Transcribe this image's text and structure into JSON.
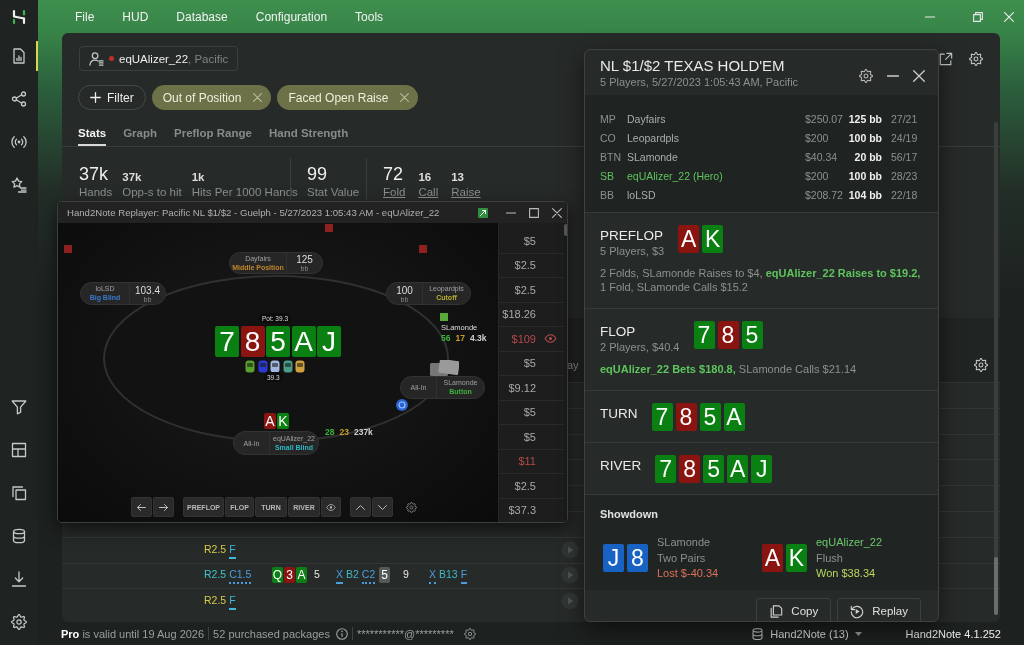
{
  "menu": [
    "File",
    "HUD",
    "Database",
    "Configuration",
    "Tools"
  ],
  "sidebar": {
    "top_items": [
      {
        "selected": true
      },
      {
        "selected": false
      },
      {
        "selected": false
      },
      {
        "selected": false
      }
    ],
    "bottom_items": [
      {
        "selected": false
      },
      {
        "selected": false
      },
      {
        "selected": false
      },
      {
        "selected": false
      },
      {
        "selected": false
      },
      {
        "selected": false
      }
    ]
  },
  "player_selector": {
    "name": "eqUAlizer_22",
    "site": ", Pacific"
  },
  "filters": {
    "add_label": "Filter",
    "chips": [
      {
        "label": "Out of Position"
      },
      {
        "label": "Faced Open Raise"
      }
    ]
  },
  "tabs": [
    {
      "label": "Stats",
      "selected": true
    },
    {
      "label": "Graph",
      "selected": false
    },
    {
      "label": "Preflop Range",
      "selected": false
    },
    {
      "label": "Hand Strength",
      "selected": false
    }
  ],
  "stats": [
    {
      "items": [
        {
          "value": "37k",
          "label": "Hands",
          "kind": "primary",
          "link": false
        },
        {
          "value": "37k",
          "label": "Opp-s to hit",
          "kind": "secondary",
          "link": false
        },
        {
          "value": "1k",
          "label": "Hits Per 1000 Hands",
          "kind": "secondary",
          "link": false
        }
      ]
    },
    {
      "items": [
        {
          "value": "99",
          "label": "Stat Value",
          "kind": "primary",
          "link": false
        }
      ]
    },
    {
      "items": [
        {
          "value": "72",
          "label": "Fold",
          "kind": "primary",
          "link": true
        },
        {
          "value": "16",
          "label": "Call",
          "kind": "secondary",
          "link": true
        },
        {
          "value": "13",
          "label": "Raise",
          "kind": "secondary",
          "link": true
        }
      ]
    }
  ],
  "table": {
    "columns": [
      {
        "label": "ay"
      }
    ],
    "rows": [
      {
        "cells": [
          {
            "tokens": [
              {
                "kind": "action",
                "text": "R2.5",
                "color": "#d6cc4a",
                "underlined": false
              },
              {
                "kind": "action",
                "text": "F",
                "color": "#3fb8d8",
                "underlined": true,
                "dotted": false
              }
            ]
          }
        ]
      },
      {
        "cells": [
          {
            "tokens": [
              {
                "kind": "action",
                "text": "R2.5",
                "color": "#3fc4cc",
                "underlined": false
              },
              {
                "kind": "action",
                "text": "C1.5",
                "color": "#4a9ee0",
                "underlined": true,
                "dotted": true
              }
            ]
          },
          {
            "tokens": [
              {
                "kind": "card",
                "text": "Q",
                "color": "#0d7f16"
              },
              {
                "kind": "card",
                "text": "3",
                "color": "#8c1410"
              },
              {
                "kind": "card",
                "text": "A",
                "color": "#0d7f16"
              }
            ]
          },
          {
            "tokens": [
              {
                "kind": "text",
                "text": "5"
              }
            ]
          },
          {
            "tokens": [
              {
                "kind": "action",
                "text": "X",
                "color": "#4a9ee0",
                "underlined": true,
                "dotted": false
              },
              {
                "kind": "action",
                "text": "B2",
                "color": "#3fb8c8",
                "underlined": false
              },
              {
                "kind": "action",
                "text": "C2",
                "color": "#4a9ee0",
                "underlined": true,
                "dotted": true
              }
            ]
          },
          {
            "tokens": [
              {
                "kind": "card",
                "text": "5",
                "color": "#555a58"
              }
            ]
          },
          {
            "tokens": [
              {
                "kind": "text",
                "text": "9"
              }
            ]
          },
          {
            "tokens": [
              {
                "kind": "action",
                "text": "X",
                "color": "#4a9ee0",
                "underlined": true,
                "dotted": true
              },
              {
                "kind": "action",
                "text": "B13",
                "color": "#3fb8c8",
                "underlined": false
              },
              {
                "kind": "action",
                "text": "F",
                "color": "#4a9ee0",
                "underlined": true,
                "dotted": false
              }
            ]
          }
        ]
      },
      {
        "cells": [
          {
            "tokens": [
              {
                "kind": "action",
                "text": "R2.5",
                "color": "#d6cc4a",
                "underlined": false
              },
              {
                "kind": "action",
                "text": "F",
                "color": "#3fb8d8",
                "underlined": true,
                "dotted": false
              }
            ]
          }
        ]
      }
    ]
  },
  "replayer": {
    "title": "Hand2Note Replayer: Pacific NL $1/$2 - Guelph - 5/27/2023 1:05:43 AM - eqUAlizer_22",
    "seats": [
      {
        "name": "Dayfairs",
        "position": "Middle Position",
        "color": "#c0862a",
        "stack": "125",
        "unit": "bb"
      },
      {
        "name": "loLSD",
        "position": "Big Blind",
        "color": "#3a78c8",
        "stack": "103.4",
        "unit": "bb"
      },
      {
        "name": "Leopardpls",
        "position": "Cutoff",
        "color": "#b8b030",
        "stack": "100",
        "unit": "bb"
      },
      {
        "name": "SLamonde",
        "position": "Button",
        "color": "#3cb43c",
        "status": "All-In"
      },
      {
        "name": "eqUAlizer_22",
        "position": "Small Blind",
        "color": "#2cb8c4",
        "status": "All-In"
      }
    ],
    "pot_label": "Pot: 39.3",
    "board": [
      {
        "rank": "7",
        "color": "#0b8012"
      },
      {
        "rank": "8",
        "color": "#8a1510"
      },
      {
        "rank": "5",
        "color": "#0b8012"
      },
      {
        "rank": "A",
        "color": "#0b8012"
      },
      {
        "rank": "J",
        "color": "#0b8012"
      }
    ],
    "pot": "39.3",
    "hero_cards": [
      {
        "rank": "A",
        "color": "#8a1510"
      },
      {
        "rank": "K",
        "color": "#0b8012"
      }
    ],
    "huds": [
      {
        "name": "SLamonde",
        "stats": [
          {
            "text": "56",
            "color": "#3cb43c"
          },
          {
            "text": "17",
            "color": "#c8a020"
          },
          {
            "text": "4.3k",
            "color": "#d0d0d0"
          }
        ]
      },
      {
        "stats": [
          {
            "text": "28",
            "color": "#3cb43c"
          },
          {
            "text": "23",
            "color": "#c8a020"
          },
          {
            "text": "237k",
            "color": "#d0d0d0"
          }
        ]
      }
    ],
    "street_buttons": [
      "PREFLOP",
      "FLOP",
      "TURN",
      "RIVER"
    ],
    "amounts": [
      {
        "text": "$5",
        "highlight": false,
        "eye": false
      },
      {
        "text": "$2.5",
        "highlight": false,
        "eye": false
      },
      {
        "text": "$2.5",
        "highlight": false,
        "eye": false
      },
      {
        "text": "$18.26",
        "highlight": false,
        "eye": false
      },
      {
        "text": "$109",
        "highlight": true,
        "eye": true
      },
      {
        "text": "$5",
        "highlight": false,
        "eye": false
      },
      {
        "text": "$9.12",
        "highlight": false,
        "eye": false
      },
      {
        "text": "$5",
        "highlight": false,
        "eye": false
      },
      {
        "text": "$5",
        "highlight": false,
        "eye": false
      },
      {
        "text": "$11",
        "highlight": true,
        "eye": false
      },
      {
        "text": "$2.5",
        "highlight": false,
        "eye": false
      },
      {
        "text": "$37.3",
        "highlight": false,
        "eye": false
      }
    ]
  },
  "hand_panel": {
    "title": "NL $1/$2 TEXAS HOLD'EM",
    "subtitle": "5 Players, 5/27/2023 1:05:43 AM, Pacific",
    "players": [
      {
        "position": "MP",
        "name": "Dayfairs",
        "money": "$250.07",
        "bb": "125 bb",
        "stats": "27/21",
        "hero": false
      },
      {
        "position": "CO",
        "name": "Leopardpls",
        "money": "$200",
        "bb": "100 bb",
        "stats": "24/19",
        "hero": false
      },
      {
        "position": "BTN",
        "name": "SLamonde",
        "money": "$40.34",
        "bb": "20 bb",
        "stats": "56/17",
        "hero": false
      },
      {
        "position": "SB",
        "name": "eqUAlizer_22 (Hero)",
        "money": "$200",
        "bb": "100 bb",
        "stats": "28/23",
        "hero": true
      },
      {
        "position": "BB",
        "name": "loLSD",
        "money": "$208.72",
        "bb": "104 bb",
        "stats": "22/18",
        "hero": false
      }
    ],
    "streets": [
      {
        "name": "PREFLOP",
        "info": "5 Players, $3",
        "cards": [
          {
            "rank": "A",
            "color": "#8a1510"
          },
          {
            "rank": "K",
            "color": "#0b8012"
          }
        ],
        "actions": "2 Folds, SLamonde Raises to $4, **eqUAlizer_22 Raises to $19.2,** 1 Fold, SLamonde Calls $15.2"
      },
      {
        "name": "FLOP",
        "info": "2 Players, $40.4",
        "cards": [
          {
            "rank": "7",
            "color": "#0b8012"
          },
          {
            "rank": "8",
            "color": "#8a1510"
          },
          {
            "rank": "5",
            "color": "#0b8012"
          }
        ],
        "actions": "**eqUAlizer_22 Bets $180.8,** SLamonde Calls $21.14"
      },
      {
        "name": "TURN",
        "cards": [
          {
            "rank": "7",
            "color": "#0b8012"
          },
          {
            "rank": "8",
            "color": "#8a1510"
          },
          {
            "rank": "5",
            "color": "#0b8012"
          },
          {
            "rank": "A",
            "color": "#0b8012"
          }
        ]
      },
      {
        "name": "RIVER",
        "cards": [
          {
            "rank": "7",
            "color": "#0b8012"
          },
          {
            "rank": "8",
            "color": "#8a1510"
          },
          {
            "rank": "5",
            "color": "#0b8012"
          },
          {
            "rank": "A",
            "color": "#0b8012"
          },
          {
            "rank": "J",
            "color": "#0b8012"
          }
        ]
      }
    ],
    "showdown": {
      "title": "Showdown",
      "players": [
        {
          "cards": [
            {
              "rank": "J",
              "color": "#1862c4"
            },
            {
              "rank": "8",
              "color": "#1862c4"
            }
          ],
          "name": "SLamonde",
          "hand": "Two Pairs",
          "result": "Lost $-40.34",
          "hero": false,
          "won": false
        },
        {
          "cards": [
            {
              "rank": "A",
              "color": "#8a1510"
            },
            {
              "rank": "K",
              "color": "#0b8012"
            }
          ],
          "name": "eqUAlizer_22",
          "hand": "Flush",
          "result": "Won $38.34",
          "hero": true,
          "won": true
        }
      ]
    },
    "buttons": [
      "Copy",
      "Replay"
    ]
  },
  "status_bar": {
    "license": "**Pro** is valid until 19 Aug 2026",
    "packages": "52 purchased packages",
    "account": "***********@*********",
    "database": "Hand2Note (13)",
    "version": "Hand2Note 4.1.252"
  }
}
